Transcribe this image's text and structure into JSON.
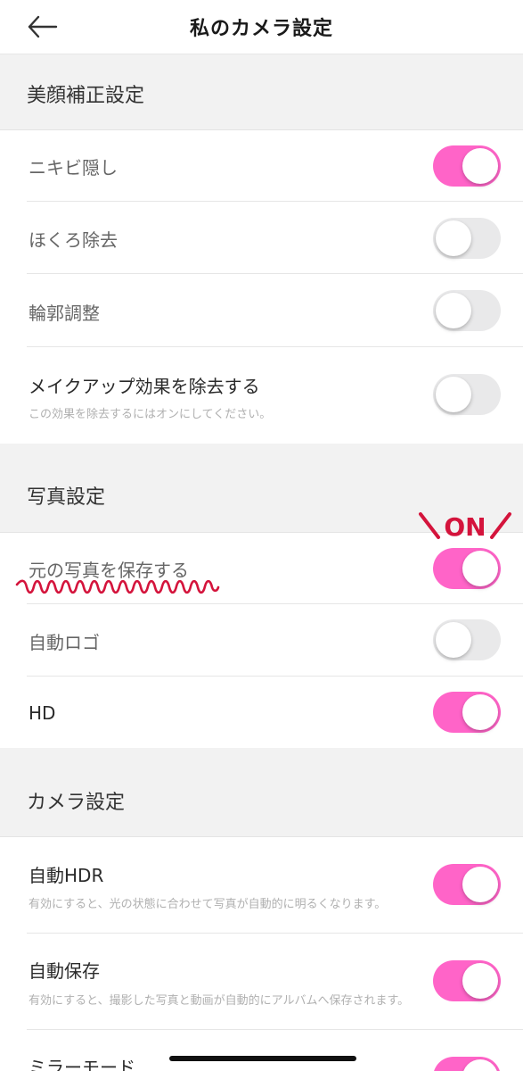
{
  "header": {
    "title": "私のカメラ設定"
  },
  "sections": [
    {
      "title": "美顔補正設定"
    },
    {
      "title": "写真設定"
    },
    {
      "title": "カメラ設定"
    }
  ],
  "beauty": {
    "acne": {
      "label": "ニキビ隠し",
      "on": true
    },
    "mole": {
      "label": "ほくろ除去",
      "on": false
    },
    "contour": {
      "label": "輪郭調整",
      "on": false
    },
    "makeup": {
      "label": "メイクアップ効果を除去する",
      "desc": "この効果を除去するにはオンにしてください。",
      "on": false
    }
  },
  "photo": {
    "save_original": {
      "label": "元の写真を保存する",
      "on": true
    },
    "auto_logo": {
      "label": "自動ロゴ",
      "on": false
    },
    "hd": {
      "label": "HD",
      "on": true
    }
  },
  "camera": {
    "auto_hdr": {
      "label": "自動HDR",
      "desc": "有効にすると、光の状態に合わせて写真が自動的に明るくなります。",
      "on": true
    },
    "auto_save": {
      "label": "自動保存",
      "desc": "有効にすると、撮影した写真と動画が自動的にアルバムへ保存されます。",
      "on": true
    },
    "mirror": {
      "label": "ミラーモード",
      "on": true
    }
  },
  "annotation": {
    "text": "ON"
  },
  "colors": {
    "toggle_on": "#ff64c8",
    "toggle_off": "#e9e9ea",
    "annotation": "#d4143c"
  },
  "icons": {
    "back": "arrow-left-icon"
  }
}
